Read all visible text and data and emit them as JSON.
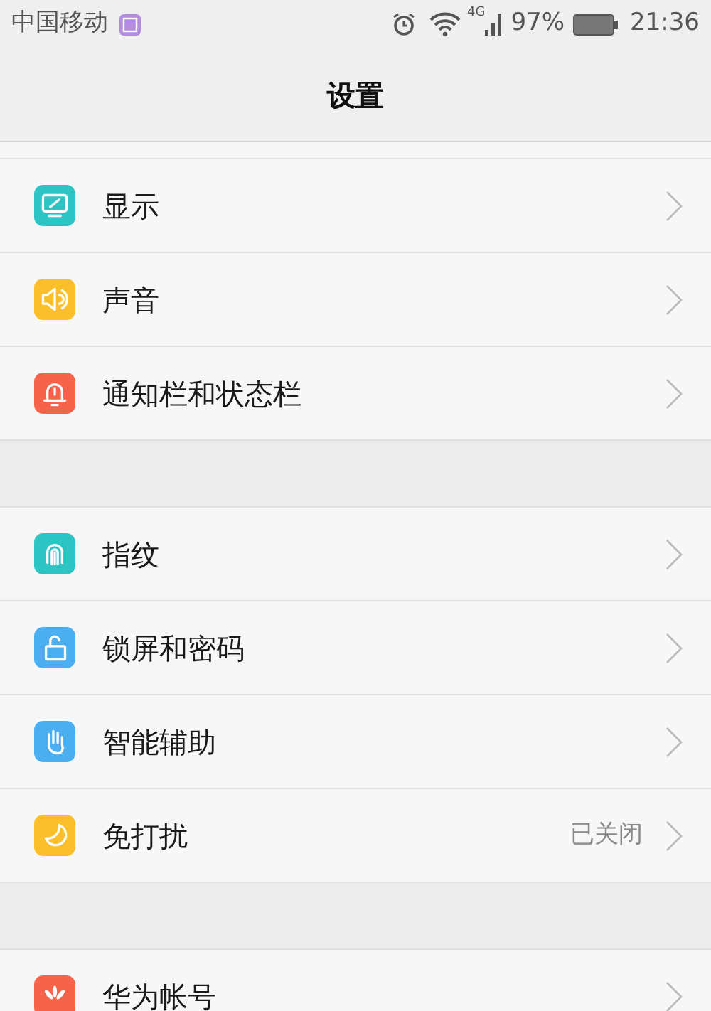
{
  "status_bar": {
    "carrier": "中国移动",
    "network": "4G",
    "battery": "97%",
    "time": "21:36"
  },
  "header": {
    "title": "设置"
  },
  "groups": [
    {
      "items": [
        {
          "kind": "display",
          "color": "#2ec4c4",
          "label": "显示"
        },
        {
          "kind": "sound",
          "color": "#fbbf2c",
          "label": "声音"
        },
        {
          "kind": "notification",
          "color": "#f5634a",
          "label": "通知栏和状态栏"
        }
      ]
    },
    {
      "items": [
        {
          "kind": "fingerprint",
          "color": "#2ec4c4",
          "label": "指纹"
        },
        {
          "kind": "lock",
          "color": "#4aaef0",
          "label": "锁屏和密码"
        },
        {
          "kind": "assist",
          "color": "#4aaef0",
          "label": "智能辅助"
        },
        {
          "kind": "disturb",
          "color": "#fbbf2c",
          "label": "免打扰",
          "value": "已关闭"
        }
      ]
    },
    {
      "items": [
        {
          "kind": "account",
          "color": "#f5634a",
          "label": "华为帐号"
        }
      ]
    }
  ]
}
